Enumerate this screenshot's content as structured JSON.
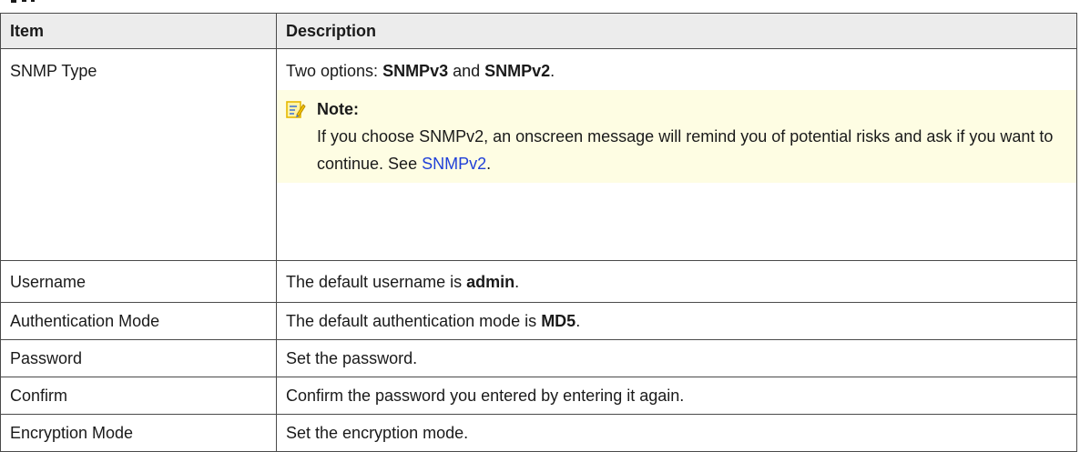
{
  "header": {
    "item": "Item",
    "description": "Description"
  },
  "rows": {
    "snmp_type": {
      "item": "SNMP Type",
      "desc_prefix": "Two options: ",
      "opt1": "SNMPv3",
      "mid": " and ",
      "opt2": "SNMPv2",
      "suffix": ".",
      "note_label": "Note:",
      "note_text": "If you choose SNMPv2, an onscreen message will remind you of potential risks and ask if you want to continue. See ",
      "note_link": "SNMPv2",
      "note_end": "."
    },
    "username": {
      "item": "Username",
      "desc_prefix": "The default username is ",
      "value": "admin",
      "suffix": "."
    },
    "auth_mode": {
      "item": "Authentication Mode",
      "desc_prefix": "The default authentication mode is ",
      "value": "MD5",
      "suffix": "."
    },
    "password": {
      "item": "Password",
      "desc": "Set the password."
    },
    "confirm": {
      "item": "Confirm",
      "desc": "Confirm the password you entered by entering it again."
    },
    "encryption": {
      "item": "Encryption Mode",
      "desc": "Set the encryption mode."
    }
  },
  "colors": {
    "header_bg": "#ececec",
    "note_bg": "#fefde3",
    "link": "#1f3fd8",
    "note_icon": "#f2c200"
  },
  "icons": {
    "note": "note-pencil-icon"
  }
}
